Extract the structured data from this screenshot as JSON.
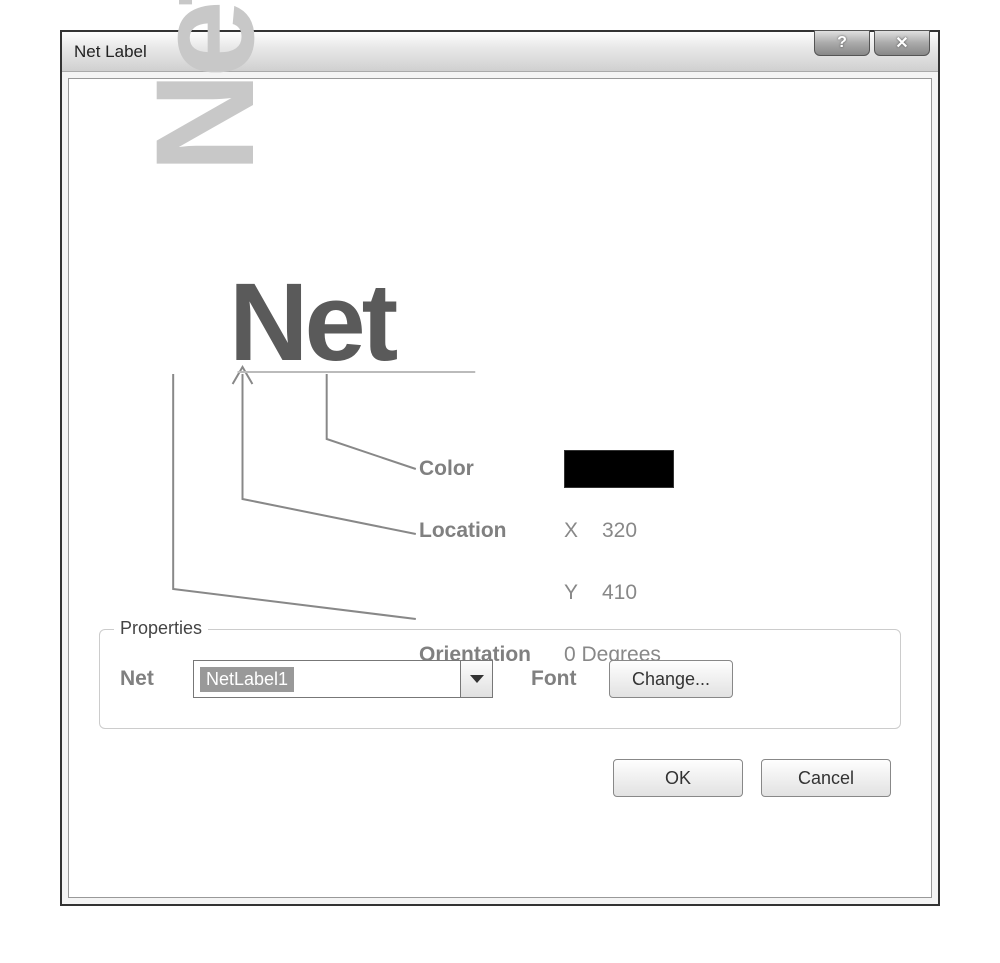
{
  "window": {
    "title": "Net Label"
  },
  "preview": {
    "rotated_text": "Net",
    "main_text": "Net"
  },
  "callout": {
    "color_label": "Color",
    "color_value": "#000000",
    "location_label": "Location",
    "x_label": "X",
    "x_value": "320",
    "y_label": "Y",
    "y_value": "410",
    "orientation_label": "Orientation",
    "orientation_value": "0 Degrees"
  },
  "properties": {
    "legend": "Properties",
    "net_label": "Net",
    "net_value": "NetLabel1",
    "font_label": "Font",
    "change_button": "Change..."
  },
  "buttons": {
    "ok": "OK",
    "cancel": "Cancel"
  }
}
